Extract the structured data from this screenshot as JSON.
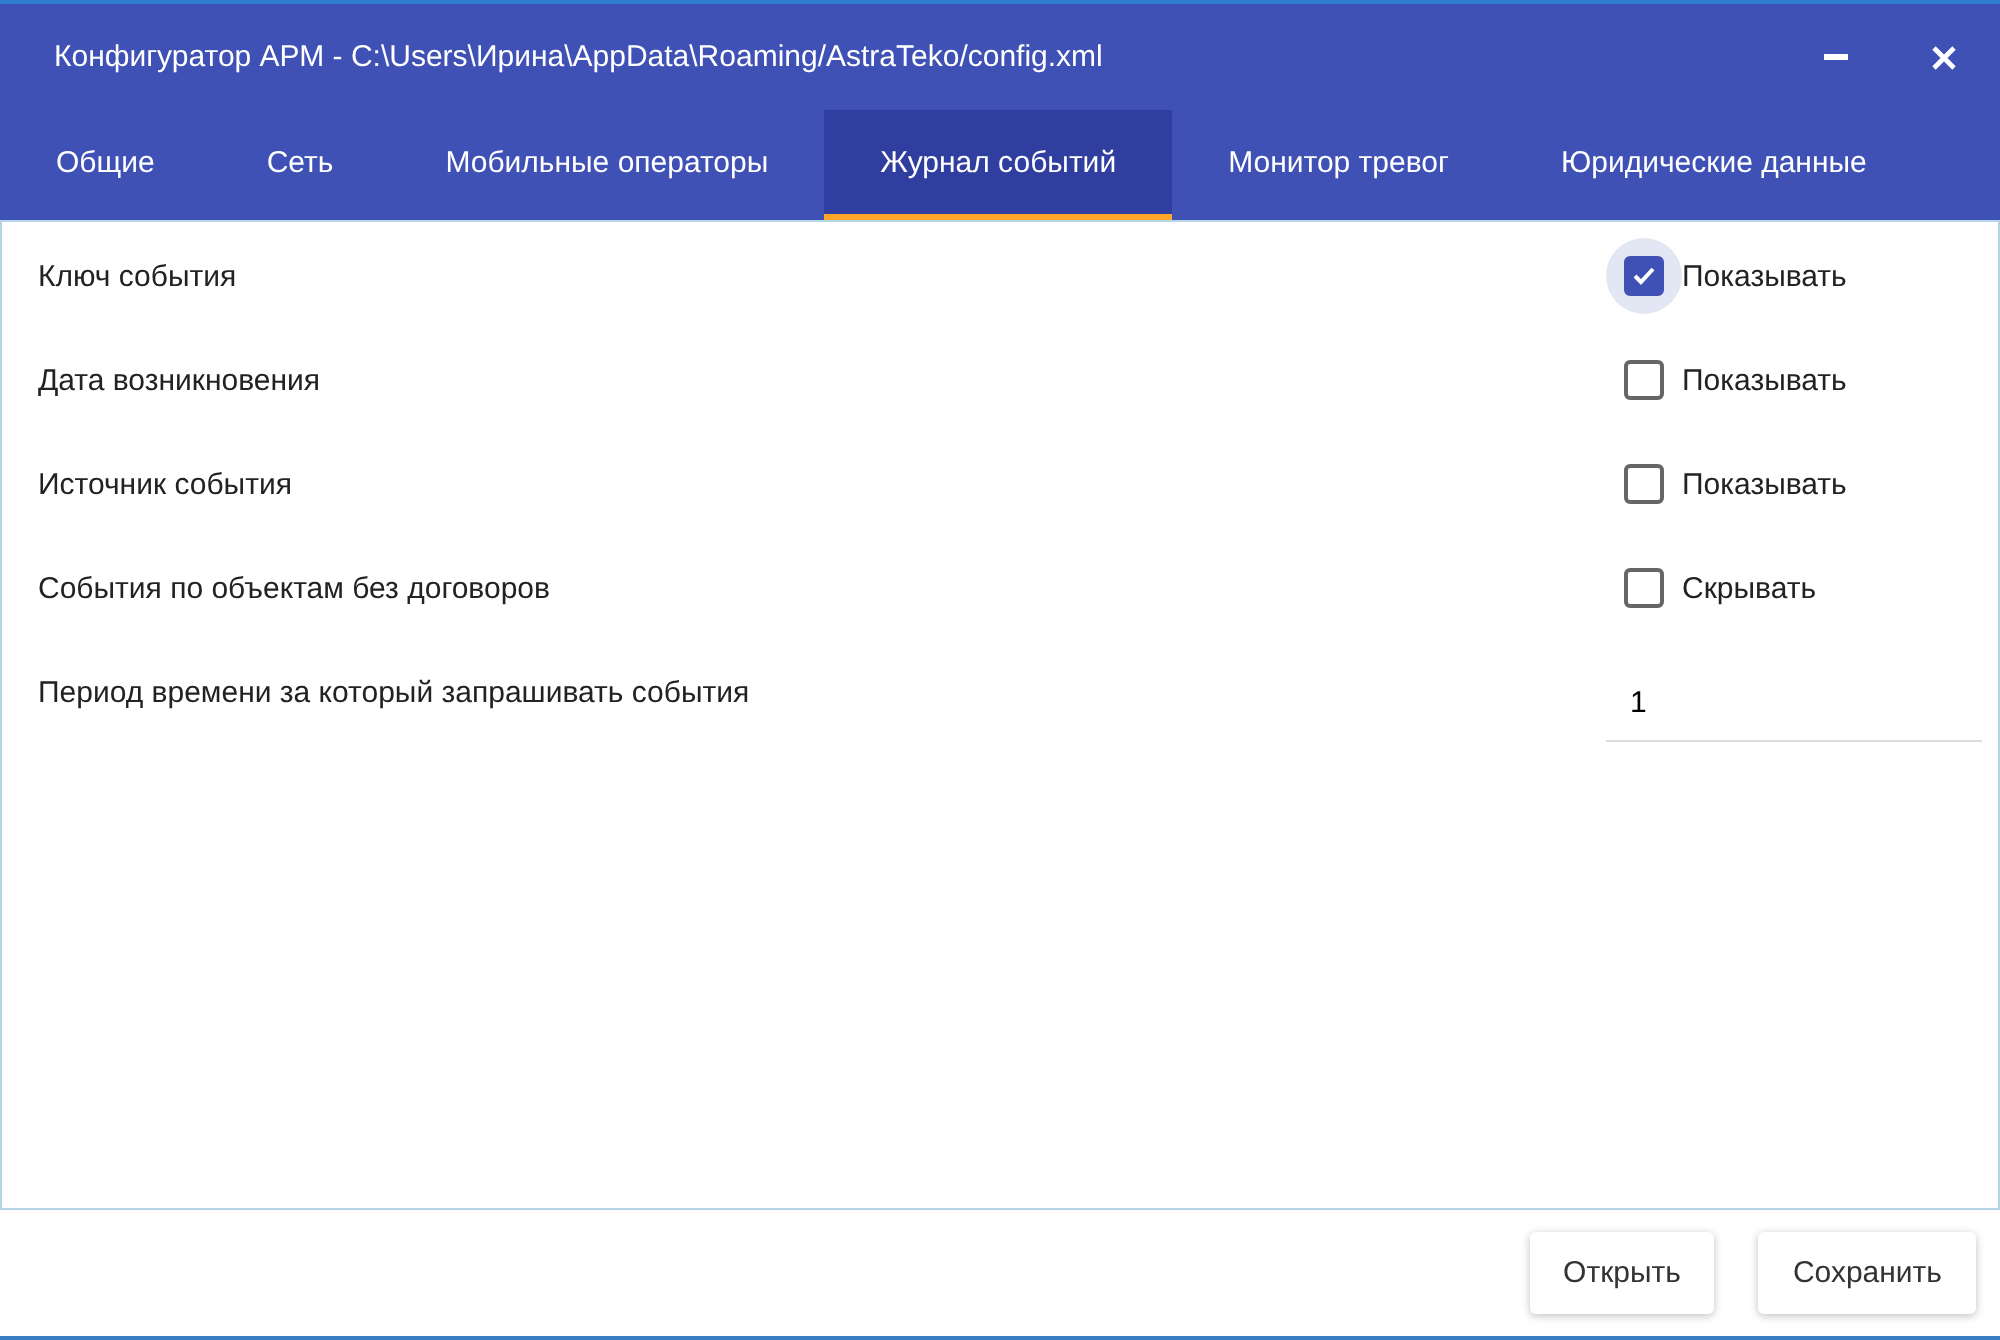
{
  "window": {
    "title": "Конфигуратор АРМ - C:\\Users\\Ирина\\AppData\\Roaming/AstraTeko/config.xml"
  },
  "tabs": [
    {
      "label": "Общие",
      "selected": false
    },
    {
      "label": "Сеть",
      "selected": false
    },
    {
      "label": "Мобильные операторы",
      "selected": false
    },
    {
      "label": "Журнал событий",
      "selected": true
    },
    {
      "label": "Монитор тревог",
      "selected": false
    },
    {
      "label": "Юридические данные",
      "selected": false
    }
  ],
  "settings": [
    {
      "kind": "checkbox",
      "label": "Ключ события",
      "option": "Показывать",
      "checked": true,
      "focused": true
    },
    {
      "kind": "checkbox",
      "label": "Дата возникновения",
      "option": "Показывать",
      "checked": false,
      "focused": false
    },
    {
      "kind": "checkbox",
      "label": "Источник события",
      "option": "Показывать",
      "checked": false,
      "focused": false
    },
    {
      "kind": "checkbox",
      "label": "События по объектам без договоров",
      "option": "Скрывать",
      "checked": false,
      "focused": false
    },
    {
      "kind": "number",
      "label": "Период времени за который запрашивать события",
      "value": "1"
    }
  ],
  "buttons": [
    "Открыть",
    "Сохранить"
  ]
}
